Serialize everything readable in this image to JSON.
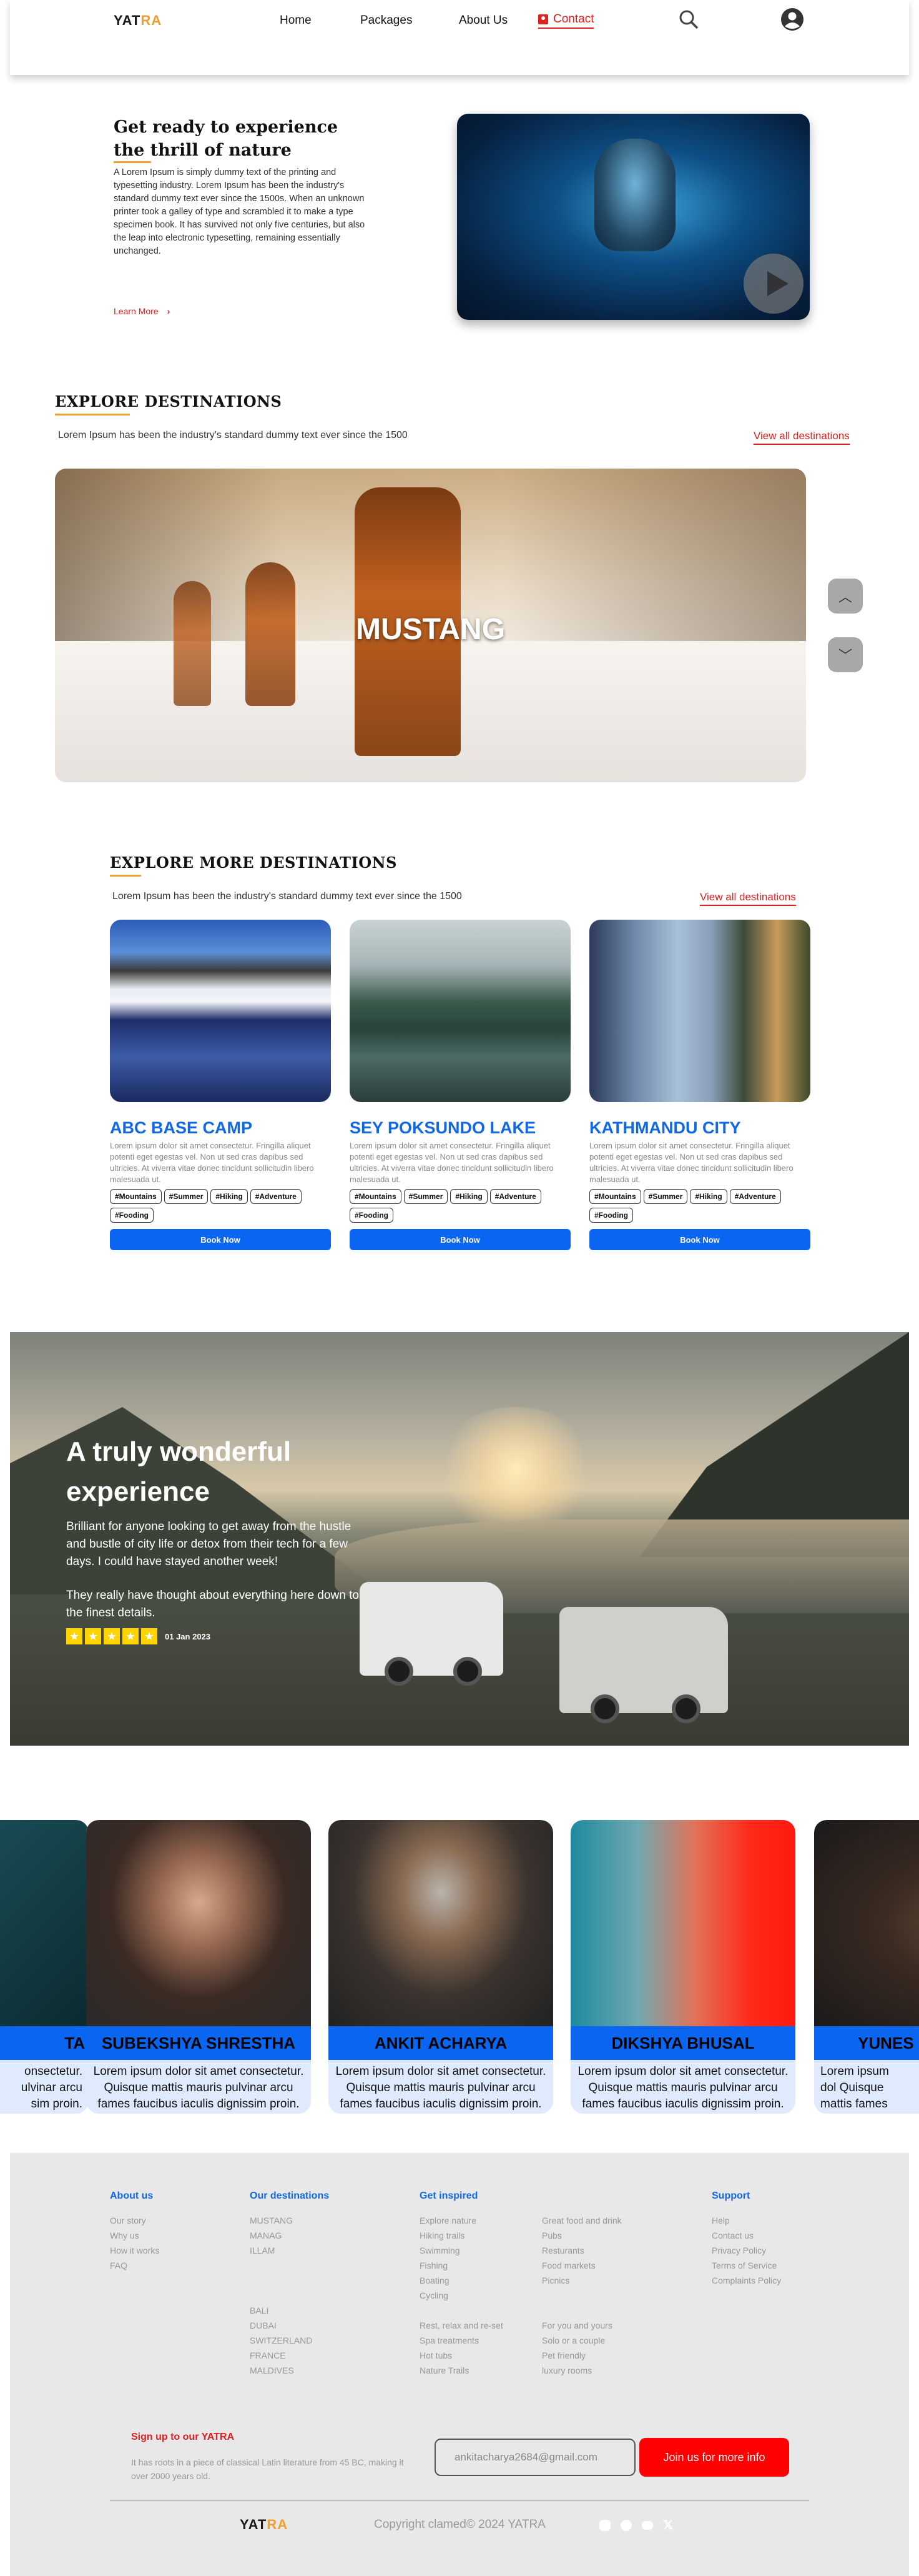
{
  "header": {
    "logo_main": "YAT",
    "logo_accent": "RA",
    "nav": [
      "Home",
      "Packages",
      "About Us"
    ],
    "contact": "Contact"
  },
  "hero": {
    "title_line1": "Get ready to experience",
    "title_line2": "the thrill of nature",
    "text": "A Lorem Ipsum is simply dummy text of the printing and typesetting industry. Lorem Ipsum has been the industry's standard dummy text ever since the 1500s. When an unknown printer took a galley of type and scrambled it to make a type specimen book. It has survived not only five centuries, but also the leap into electronic typesetting, remaining essentially unchanged.",
    "learn_more": "Learn More"
  },
  "explore": {
    "title": "EXPLORE DESTINATIONS",
    "subtitle": "Lorem Ipsum has been the industry's standard dummy text ever since the 1500",
    "view_all": "View all destinations",
    "slide_label": "MUSTANG"
  },
  "explore_more": {
    "title": "EXPLORE MORE  DESTINATIONS",
    "subtitle": "Lorem Ipsum has been the industry's standard dummy text ever since the 1500",
    "view_all": "View all destinations",
    "cards": [
      {
        "title": "ABC BASE CAMP",
        "text": "Lorem ipsum dolor sit amet consectetur. Fringilla aliquet potenti eget egestas vel. Non ut sed cras dapibus sed ultricies. At viverra vitae donec tincidunt sollicitudin libero malesuada ut.",
        "tags": [
          "#Mountains",
          "#Summer",
          "#Hiking",
          "#Adventure",
          "#Fooding"
        ],
        "button": "Book Now"
      },
      {
        "title": "SEY POKSUNDO LAKE",
        "text": "Lorem ipsum dolor sit amet consectetur. Fringilla aliquet potenti eget egestas vel. Non ut sed cras dapibus sed ultricies. At viverra vitae donec tincidunt sollicitudin libero malesuada ut.",
        "tags": [
          "#Mountains",
          "#Summer",
          "#Hiking",
          "#Adventure",
          "#Fooding"
        ],
        "button": "Book Now"
      },
      {
        "title": "KATHMANDU CITY",
        "text": "Lorem ipsum dolor sit amet consectetur. Fringilla aliquet potenti eget egestas vel. Non ut sed cras dapibus sed ultricies. At viverra vitae donec tincidunt sollicitudin libero malesuada ut.",
        "tags": [
          "#Mountains",
          "#Summer",
          "#Hiking",
          "#Adventure",
          "#Fooding"
        ],
        "button": "Book Now"
      }
    ]
  },
  "banner": {
    "title_line1": "A truly wonderful",
    "title_line2": "experience",
    "text1": "Brilliant for anyone looking to get away from the hustle and bustle of city life or detox from their tech for a few days. I could have stayed another week!",
    "text2": "They really have thought about everything here down to the finest details.",
    "stars": 5,
    "date": "01 Jan 2023"
  },
  "testimonials": {
    "partial_left": {
      "name": "TA",
      "quote": "onsectetur. ulvinar arcu sim proin."
    },
    "items": [
      {
        "name": "SUBEKSHYA SHRESTHA",
        "quote": "Lorem ipsum dolor sit amet consectetur. Quisque mattis mauris pulvinar arcu fames faucibus iaculis dignissim proin.",
        "stars": "★★★★★"
      },
      {
        "name": "ANKIT ACHARYA",
        "quote": "Lorem ipsum dolor sit amet consectetur. Quisque mattis mauris pulvinar arcu fames faucibus iaculis dignissim proin.",
        "stars": "★★★★★"
      },
      {
        "name": "DIKSHYA BHUSAL",
        "quote": "Lorem ipsum dolor sit amet consectetur. Quisque mattis mauris pulvinar arcu fames faucibus iaculis dignissim proin.",
        "stars": "★★★★★"
      }
    ],
    "partial_right": {
      "name": "YUNES",
      "quote": "Lorem ipsum dol Quisque mattis fames faucibus i"
    }
  },
  "footer": {
    "about": {
      "title": "About us",
      "links": [
        "Our story",
        "Why us",
        "How it works",
        "FAQ"
      ]
    },
    "destinations": {
      "title": "Our destinations",
      "links1": [
        "MUSTANG",
        "MANAG",
        "ILLAM"
      ],
      "links2": [
        "BALI",
        "DUBAI",
        "SWITZERLAND",
        "FRANCE",
        "MALDIVES"
      ]
    },
    "inspired": {
      "title": "Get inspired",
      "col1a": [
        "Explore nature",
        "Hiking trails",
        "Swimming",
        "Fishing",
        "Boating",
        "Cycling"
      ],
      "col1b": [
        "Rest, relax and re-set",
        "Spa treatments",
        "Hot tubs",
        "Nature Trails"
      ],
      "col2a": [
        "Great food and drink",
        "Pubs",
        "Resturants",
        "Food markets",
        "Picnics"
      ],
      "col2b": [
        "For you and yours",
        "Solo or a couple",
        "Pet friendly",
        "luxury rooms"
      ]
    },
    "support": {
      "title": "Support",
      "links": [
        "Help",
        "Contact us",
        "Privacy Policy",
        "Terms of Service",
        "Complaints Policy"
      ]
    },
    "signup": {
      "title": "Sign up to our YATRA",
      "text": "It has roots in a piece of classical Latin literature from 45 BC, making it over 2000 years old.",
      "email": "ankitacharya2684@gmail.com",
      "button": "Join us for more info"
    },
    "copyright": "Copyright clamed© 2024 YATRA"
  }
}
